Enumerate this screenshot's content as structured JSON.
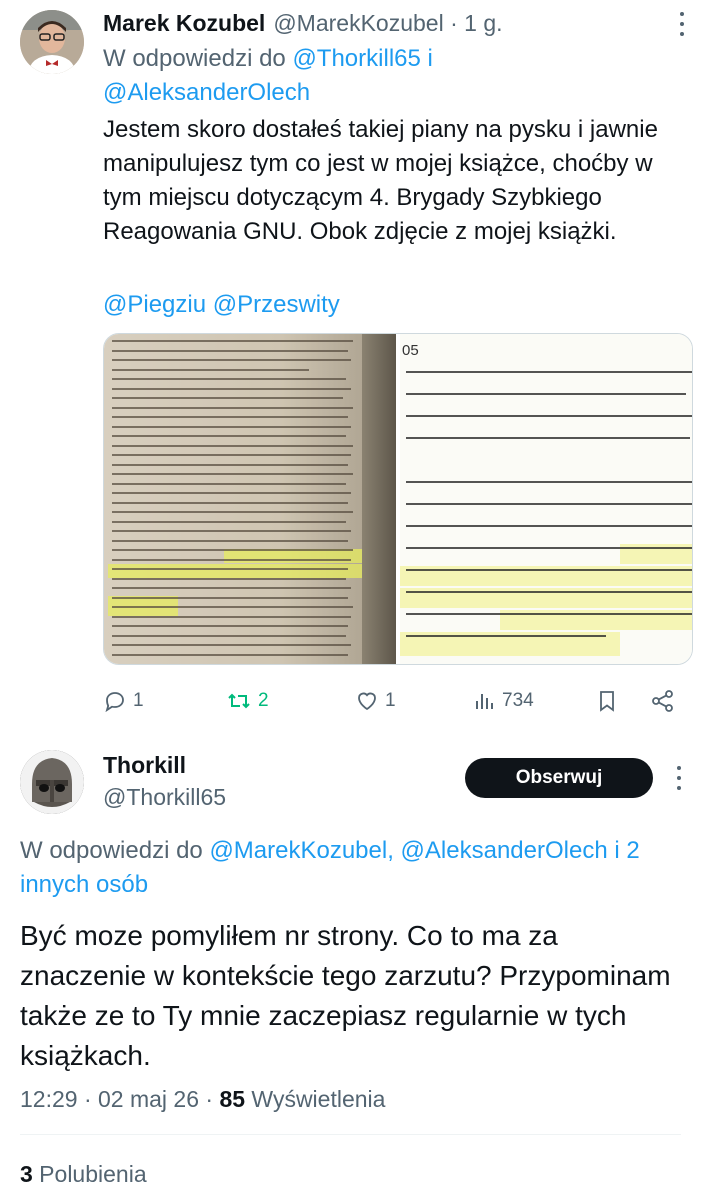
{
  "tweet1": {
    "author_name": "Marek Kozubel",
    "author_handle": "@MarekKozubel · 1 g.",
    "reply_prefix": "W odpowiedzi do ",
    "reply_mentions": "@Thorkill65 i @AleksanderOlech",
    "text": "Jestem skoro dostałeś takiej piany na pysku i jawnie manipulujesz tym co jest w mojej książce, choćby w tym miejscu dotyczącym 4. Brygady Szybkiego Reagowania GNU. Obok zdjęcie z mojej książki.",
    "mentions": "@Piegziu @Przeswity",
    "media_left_header": "wo srogie rozkazy – wspomina [Mychajło] Podolak [doradca k",
    "media_right_page": "05",
    "media_right_text": [
      "ończu osłabieni Rosjanie wycofali się c",
      "niej z płd części lotniska (tam wykona",
      "cie uradowanych ukraińskich żołnierzy",
      "trafiło do mediów społecznościowyc",
      "nie zgeolokalizował zdjęcia o którym p",
      ", wiec twierdzenie że zrobiono je rzeko",
      "l części lotniska Antonowa to jego wyn",
      "cie przedstawia poborowych żołnierzy",
      "siedzących lub leżących na pryczach v",
      "aś magazynie. Autor wcześniej nie umi",
      "dnostki na liście tych jw które miały br",
      "l w rzekomym kontrataku."
    ],
    "actions": {
      "replies": "1",
      "retweets": "2",
      "likes": "1",
      "views": "734"
    },
    "colors": {
      "retweet_active": "#00ba7c",
      "link": "#1d9bf0"
    }
  },
  "tweet2": {
    "author_name": "Thorkill",
    "author_handle": "@Thorkill65",
    "follow_label": "Obserwuj",
    "reply_prefix": "W odpowiedzi do ",
    "reply_mentions": "@MarekKozubel, @AleksanderOlech i 2 innych osób",
    "text": "Być moze pomyliłem nr strony. Co to ma za znaczenie w kontekście tego zarzutu? Przypominam także ze to Ty mnie zaczepiasz regularnie w tych książkach.",
    "time": "12:29 · 02 maj 26 · ",
    "views_count": "85",
    "views_label": " Wyświetlenia",
    "likes_count": "3",
    "likes_label": " Polubienia"
  }
}
